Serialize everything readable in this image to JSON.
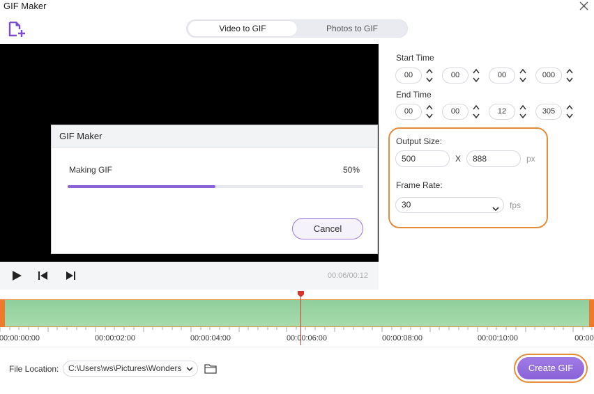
{
  "window": {
    "title": "GIF Maker"
  },
  "mode_tabs": [
    {
      "label": "Video to GIF",
      "active": true
    },
    {
      "label": "Photos to GIF",
      "active": false
    }
  ],
  "player": {
    "time_readout": "00:06/00:12"
  },
  "progress_dialog": {
    "title": "GIF Maker",
    "status": "Making GIF",
    "percent_label": "50%",
    "progress": 0.5,
    "cancel_label": "Cancel"
  },
  "start_time": {
    "label": "Start Time",
    "fields": [
      "00",
      "00",
      "00",
      "000"
    ]
  },
  "end_time": {
    "label": "End Time",
    "fields": [
      "00",
      "00",
      "12",
      "305"
    ]
  },
  "output_size": {
    "label": "Output Size:",
    "width": "500",
    "separator": "X",
    "height": "888",
    "unit": "px"
  },
  "frame_rate": {
    "label": "Frame Rate:",
    "value": "30",
    "unit": "fps"
  },
  "timeline": {
    "ticks": [
      "00:00:00:00",
      "00:00:02:00",
      "00:00:04:00",
      "00:00:06:00",
      "00:00:08:00",
      "00:00:10:00",
      "00:00"
    ],
    "playhead_time": "00:00:06:00"
  },
  "file_location": {
    "label": "File Location:",
    "path": "C:\\Users\\ws\\Pictures\\Wonders"
  },
  "create_label": "Create GIF",
  "colors": {
    "accent": "#8c63d6",
    "highlight": "#e48c3a",
    "track": "#a8dbab",
    "playhead": "#d9332b"
  },
  "icons": [
    "add-file-icon",
    "close-icon",
    "play-icon",
    "previous-frame-icon",
    "next-frame-icon",
    "chevron-down-icon",
    "folder-icon"
  ]
}
